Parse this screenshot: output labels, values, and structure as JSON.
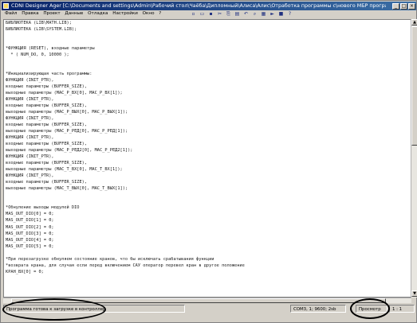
{
  "window": {
    "title": "CDNI Designer  Ager  [C:\\Documents and settings\\Admin\\Рабочий стол\\Чаёба\\Дипломный\\Алиса\\Алис\\Отработка программы с\\нового МБР программ]",
    "minimize_label": "_",
    "maximize_label": "□",
    "close_label": "×"
  },
  "menu": [
    "Файл",
    "Правка",
    "Проект",
    "Данные",
    "Отладка",
    "Настройки",
    "Окно",
    "?"
  ],
  "toolbar": {
    "icons": [
      "new-icon",
      "open-icon",
      "save-icon",
      "cut-icon",
      "copy-icon",
      "paste-icon",
      "undo-icon",
      "find-icon",
      "compile-icon",
      "run-icon",
      "stop-icon",
      "help-icon"
    ],
    "glyphs": [
      "▫",
      "▭",
      "▪",
      "✂",
      "⎘",
      "▤",
      "↶",
      "⌕",
      "▦",
      "►",
      "■",
      "?"
    ]
  },
  "code_lines": [
    "БИБЛИОТЕКА (LIB\\MATH.LIB);",
    "БИБЛИОТЕКА (LIB\\SYSTEM.LIB);",
    "",
    "",
    "*ФУНКЦИЯ (RESET), входные параметры",
    "  * ( NUM_DO, 0, 10000 );",
    "",
    "",
    "*Инициализирующая часть программы:",
    "ФУНКЦИЯ (INIT_PTR),",
    "входные параметры (BUFFER_SIZE),",
    "выходные параметры (MAC_P_BX[0], MAC_P_BX[1]);",
    "ФУНКЦИЯ (INIT_PTR),",
    "входные параметры (BUFFER_SIZE),",
    "выходные параметры (MAC_P_ВЫХ[0], MAC_P_ВЫХ[1]);",
    "ФУНКЦИЯ (INIT_PTR),",
    "входные параметры (BUFFER_SIZE),",
    "выходные параметры (MAC_P_РЕД[0], MAC_P_РЕД[1]);",
    "ФУНКЦИЯ (INIT_PTR),",
    "входные параметры (BUFFER_SIZE),",
    "выходные параметры (MAC_P_РЕД2[0], MAC_P_РЕД2[1]);",
    "ФУНКЦИЯ (INIT_PTR),",
    "входные параметры (BUFFER_SIZE),",
    "выходные параметры (MAC_T_BX[0], MAC_T_BX[1]);",
    "ФУНКЦИЯ (INIT_PTR),",
    "входные параметры (BUFFER_SIZE),",
    "выходные параметры (MAC_T_ВЫХ[0], MAC_T_ВЫХ[1]);",
    "",
    "",
    "*Обнуление выходы модулей DIO",
    "MAS_OUT_DIO[0] = 0;",
    "MAS_OUT_DIO[1] = 0;",
    "MAS_OUT_DIO[2] = 0;",
    "MAS_OUT_DIO[3] = 0;",
    "MAS_OUT_DIO[4] = 0;",
    "MAS_OUT_DIO[5] = 0;",
    "",
    "*При перезагрузке обнуляем состояние кранов, что бы исключать срабатывания функции",
    "*возврата крана, для случая если перед включением САУ оператор перевел кран в другое положение",
    "КРАН_BX[0] = 0;"
  ],
  "status": {
    "message": "Программа готова к загрузке в контроллер",
    "port": "COM3, 1; 9600; 2sb",
    "mode": "Просмотр",
    "position": "1 : 1"
  },
  "scrollbar": {
    "up_arrow": "▲",
    "down_arrow": "▼",
    "left_arrow": "◄",
    "right_arrow": "►"
  }
}
